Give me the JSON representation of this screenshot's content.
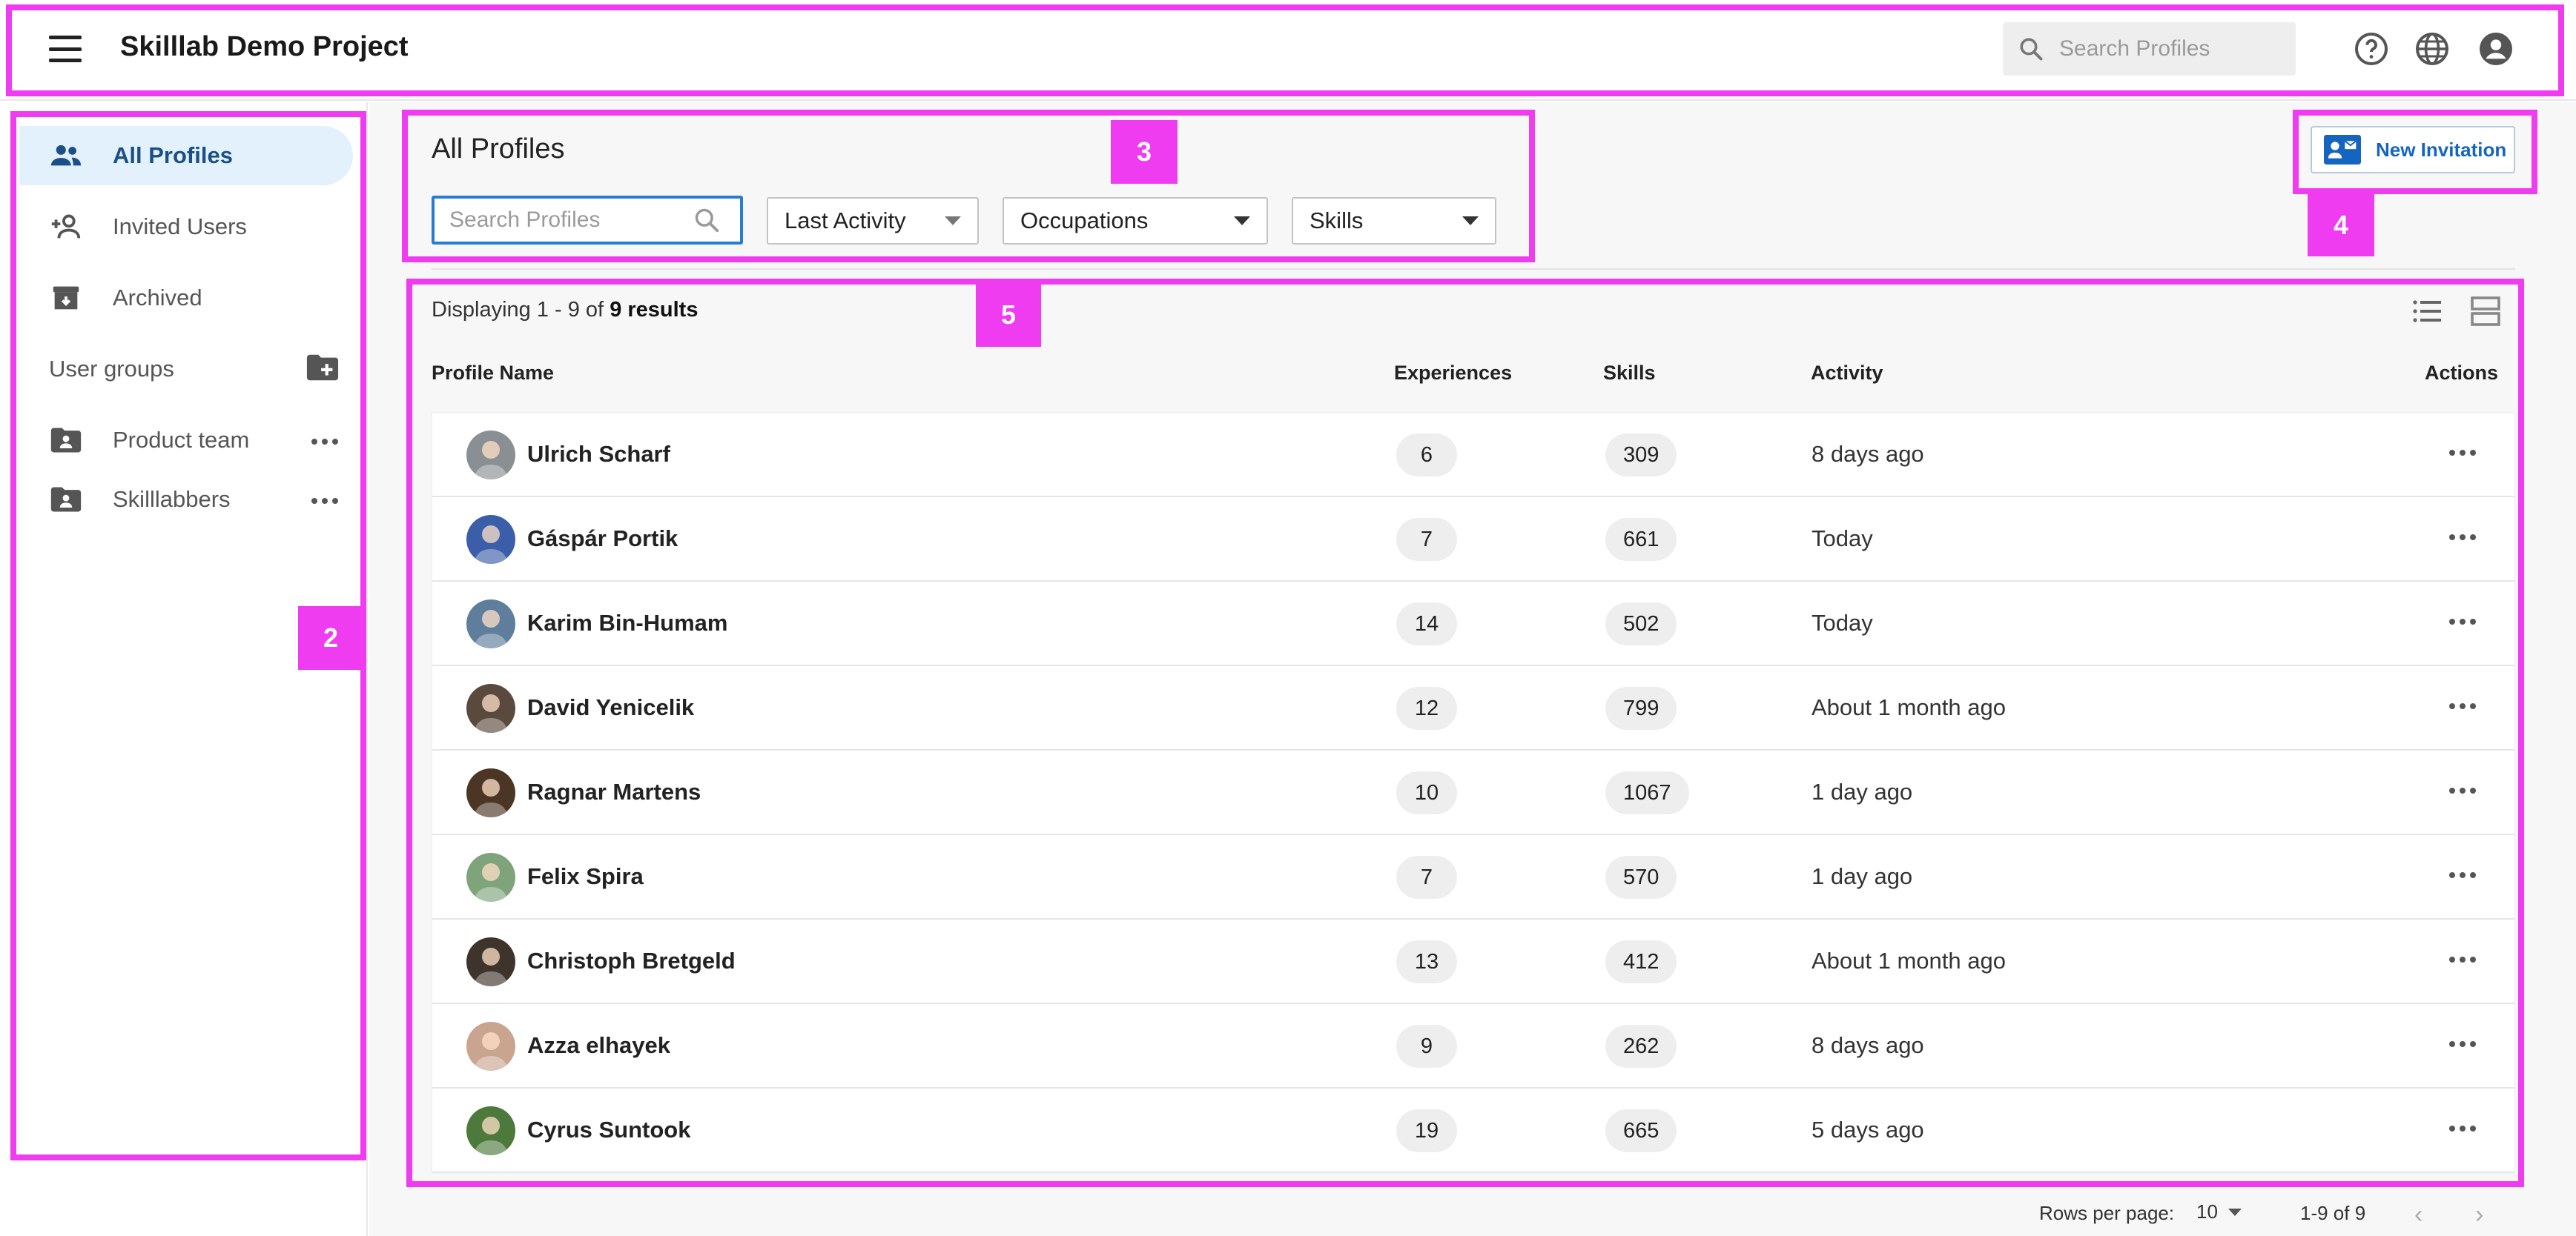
{
  "header": {
    "title": "Skilllab Demo Project",
    "search_placeholder": "Search Profiles"
  },
  "sidebar": {
    "items": [
      {
        "label": "All Profiles",
        "icon": "people-icon"
      },
      {
        "label": "Invited Users",
        "icon": "person-add-icon"
      },
      {
        "label": "Archived",
        "icon": "archive-icon"
      }
    ],
    "groups_label": "User groups",
    "groups": [
      {
        "label": "Product team"
      },
      {
        "label": "Skilllabbers"
      }
    ]
  },
  "main": {
    "title": "All Profiles",
    "search_placeholder": "Search Profiles",
    "filters": [
      "Last Activity",
      "Occupations",
      "Skills"
    ],
    "invite_label": "New Invitation",
    "displaying_prefix": "Displaying 1 - 9 of",
    "displaying_bold": "9 results",
    "columns": [
      "Profile Name",
      "Experiences",
      "Skills",
      "Activity",
      "Actions"
    ],
    "rows": [
      {
        "name": "Ulrich Scharf",
        "experiences": "6",
        "skills": "309",
        "activity": "8 days ago",
        "avatar_color": "#8a8f94"
      },
      {
        "name": "Gáspár Portik",
        "experiences": "7",
        "skills": "661",
        "activity": "Today",
        "avatar_color": "#3b5ea8"
      },
      {
        "name": "Karim Bin-Humam",
        "experiences": "14",
        "skills": "502",
        "activity": "Today",
        "avatar_color": "#5f7d9c"
      },
      {
        "name": "David Yenicelik",
        "experiences": "12",
        "skills": "799",
        "activity": "About 1 month ago",
        "avatar_color": "#5a4a3e"
      },
      {
        "name": "Ragnar Martens",
        "experiences": "10",
        "skills": "1067",
        "activity": "1 day ago",
        "avatar_color": "#4b3524"
      },
      {
        "name": "Felix Spira",
        "experiences": "7",
        "skills": "570",
        "activity": "1 day ago",
        "avatar_color": "#7fa37a"
      },
      {
        "name": "Christoph Bretgeld",
        "experiences": "13",
        "skills": "412",
        "activity": "About 1 month ago",
        "avatar_color": "#3e342c"
      },
      {
        "name": "Azza elhayek",
        "experiences": "9",
        "skills": "262",
        "activity": "8 days ago",
        "avatar_color": "#c9a58f"
      },
      {
        "name": "Cyrus Suntook",
        "experiences": "19",
        "skills": "665",
        "activity": "5 days ago",
        "avatar_color": "#4d7a3c"
      }
    ]
  },
  "footer": {
    "rows_per_page_label": "Rows per page:",
    "rows_per_page_value": "10",
    "range": "1-9 of 9"
  },
  "annotations": [
    "2",
    "3",
    "4",
    "5"
  ],
  "colors": {
    "accent": "#1565c0",
    "highlight": "#f03cf0",
    "active_bg": "#e3f1fc"
  }
}
